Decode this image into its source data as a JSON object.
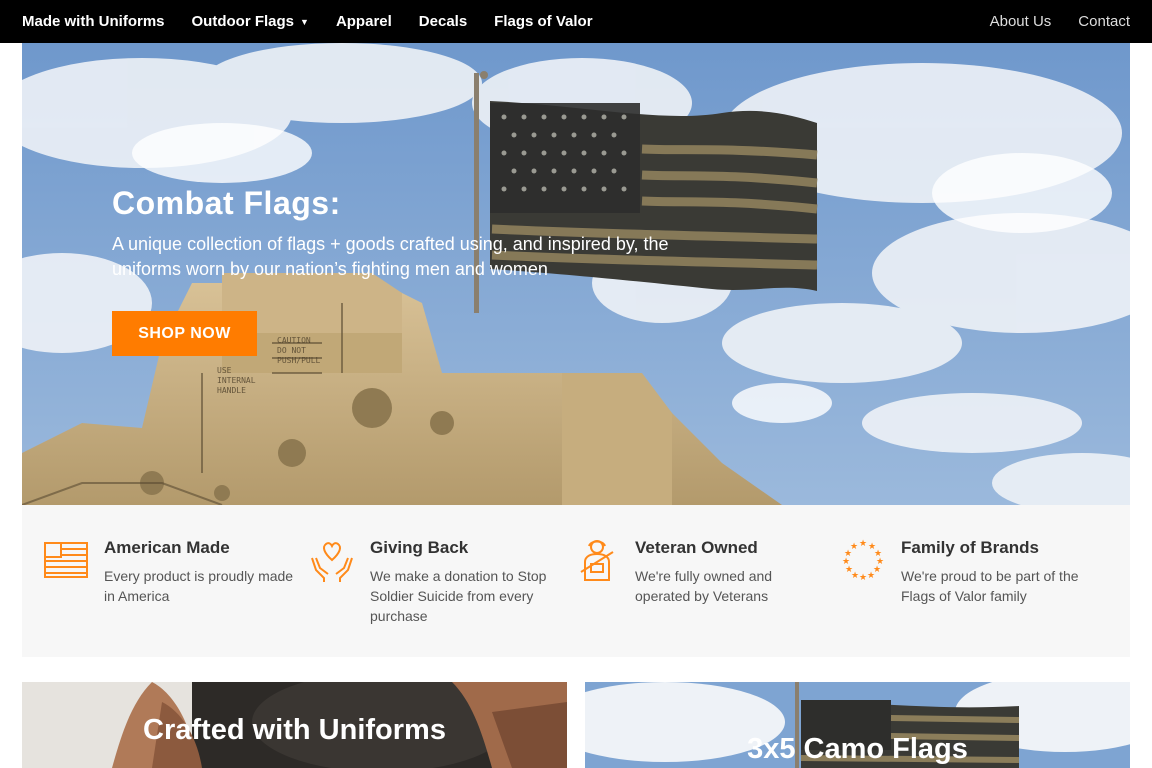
{
  "nav": {
    "left_items": [
      {
        "label": "Made with Uniforms"
      },
      {
        "label": "Outdoor Flags",
        "has_dropdown": true
      },
      {
        "label": "Apparel"
      },
      {
        "label": "Decals"
      },
      {
        "label": "Flags of Valor"
      }
    ],
    "right_items": [
      {
        "label": "About Us"
      },
      {
        "label": "Contact"
      }
    ],
    "dropdown_icon": "chevron-down-icon"
  },
  "hero": {
    "title": "Combat Flags:",
    "subtitle": "A unique collection of flags + goods crafted using, and inspired by, the uniforms worn by our nation’s fighting men and women",
    "cta_label": "SHOP NOW",
    "cta_color": "#ff7c00"
  },
  "features": [
    {
      "icon": "flag-icon",
      "title": "American Made",
      "desc": "Every product is proudly made in America"
    },
    {
      "icon": "heart-hands-icon",
      "title": "Giving Back",
      "desc": "We make a donation to Stop Soldier Suicide from every purchase"
    },
    {
      "icon": "soldier-icon",
      "title": "Veteran Owned",
      "desc": "We're fully owned and operated by Veterans"
    },
    {
      "icon": "star-circle-icon",
      "title": "Family of Brands",
      "desc": "We're proud to be part of the Flags of Valor family"
    }
  ],
  "cards": [
    {
      "title": "Crafted with Uniforms"
    },
    {
      "title": "3x5 Camo Flags"
    }
  ],
  "colors": {
    "accent": "#ff7c00",
    "nav_bg": "#000000",
    "feature_bg": "#f7f7f7"
  }
}
